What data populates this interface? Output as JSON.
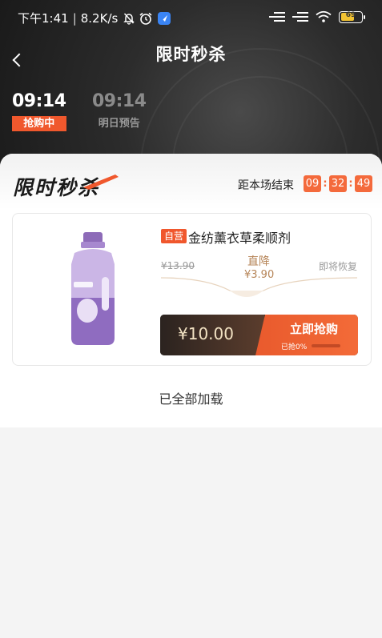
{
  "status_bar": {
    "time": "下午1:41",
    "separator": "|",
    "speed": "8.2K/s",
    "battery": "69"
  },
  "header": {
    "title": "限时秒杀"
  },
  "tabs": [
    {
      "time": "09:14",
      "status": "抢购中",
      "active": true
    },
    {
      "time": "09:14",
      "status": "明日预告",
      "active": false
    }
  ],
  "promo": {
    "brand_title": "限时秒杀",
    "countdown_label": "距本场结束",
    "countdown": {
      "hours": "09",
      "minutes": "32",
      "seconds": "49"
    },
    "separator": ":"
  },
  "product": {
    "badge": "自营",
    "name": "金纺薰衣草柔顺剂",
    "original_price": "¥13.90",
    "drop_label": "直降",
    "drop_amount": "¥3.90",
    "restore_text": "即将恢复",
    "sale_price": "¥10.00",
    "buy_label": "立即抢购",
    "grabbed_text": "已抢0%",
    "grabbed_fraction": 0
  },
  "footer": {
    "loaded_text": "已全部加载"
  },
  "colors": {
    "accent": "#f0582d",
    "price_gold": "#b68457",
    "dark_bar": "#2b231f"
  },
  "icons": {
    "back": "chevron-left-icon",
    "mute": "bell-off-icon",
    "alarm": "alarm-icon",
    "app_badge": "rocket-icon",
    "signal": "signal-bars-icon",
    "wifi": "wifi-icon",
    "battery": "battery-icon"
  }
}
